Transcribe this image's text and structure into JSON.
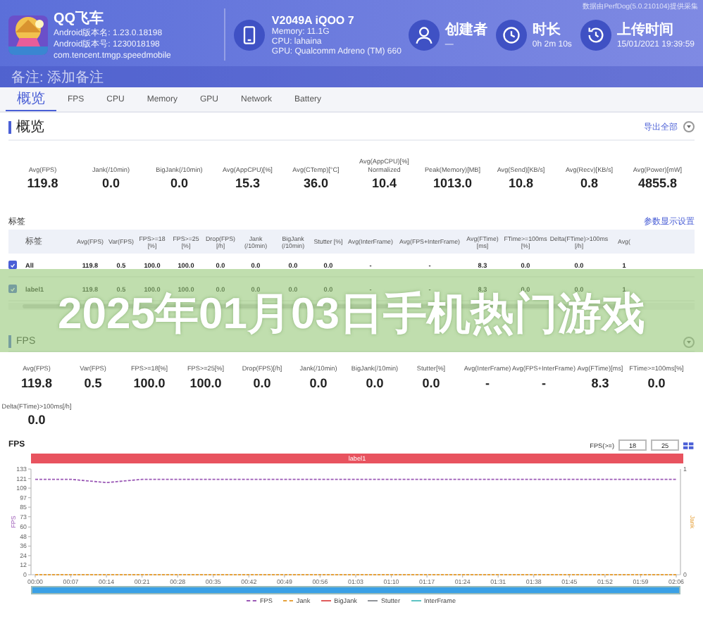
{
  "header": {
    "app": {
      "name": "QQ飞车",
      "version_name": "Android版本名: 1.23.0.18198",
      "version_code": "Android版本号: 1230018198",
      "package": "com.tencent.tmgp.speedmobile"
    },
    "device": {
      "model": "V2049A iQOO 7",
      "memory": "Memory: 11.1G",
      "cpu": "CPU: lahaina",
      "gpu": "GPU: Qualcomm Adreno (TM) 660"
    },
    "info": [
      {
        "kind": "person",
        "label": "创建者",
        "value": "—"
      },
      {
        "kind": "clock",
        "label": "时长",
        "value": "0h 2m 10s"
      },
      {
        "kind": "history",
        "label": "上传时间",
        "value": "15/01/2021 19:39:59"
      }
    ],
    "source_note": "数据由PerfDog(5.0.210104)提供采集",
    "remark": "备注: 添加备注"
  },
  "tabs": [
    {
      "label": "概览",
      "selected": true
    },
    {
      "label": "FPS",
      "selected": false
    },
    {
      "label": "CPU",
      "selected": false
    },
    {
      "label": "Memory",
      "selected": false
    },
    {
      "label": "GPU",
      "selected": false
    },
    {
      "label": "Network",
      "selected": false
    },
    {
      "label": "Battery",
      "selected": false
    }
  ],
  "overview": {
    "title": "概览",
    "link": "导出全部",
    "stats": [
      {
        "label": "Avg(FPS)",
        "value": "119.8"
      },
      {
        "label": "Jank(/10min)",
        "value": "0.0"
      },
      {
        "label": "BigJank(/10min)",
        "value": "0.0"
      },
      {
        "label": "Avg(AppCPU)[%]",
        "value": "15.3"
      },
      {
        "label": "Avg(CTemp)[°C]",
        "value": "36.0"
      },
      {
        "label": "Avg(AppCPU)[%] Normalized",
        "value": "10.4"
      },
      {
        "label": "Peak(Memory)[MB]",
        "value": "1013.0"
      },
      {
        "label": "Avg(Send)[KB/s]",
        "value": "10.8"
      },
      {
        "label": "Avg(Recv)[KB/s]",
        "value": "0.8"
      },
      {
        "label": "Avg(Power)[mW]",
        "value": "4855.8"
      }
    ]
  },
  "labels": {
    "title": "标签",
    "link": "参数显示设置",
    "columns": [
      "标签",
      "Avg(FPS)",
      "Var(FPS)",
      "FPS>=18 [%]",
      "FPS>=25 [%]",
      "Drop(FPS) [/h]",
      "Jank (/10min)",
      "BigJank (/10min)",
      "Stutter [%]",
      "Avg(InterFrame)",
      "Avg(FPS+InterFrame)",
      "Avg(FTime) [ms]",
      "FTime>=100ms [%]",
      "Delta(FTime)>100ms [/h]",
      "Avg("
    ],
    "rows": [
      {
        "checked": true,
        "cells": [
          "All",
          "119.8",
          "0.5",
          "100.0",
          "100.0",
          "0.0",
          "0.0",
          "0.0",
          "0.0",
          "-",
          "-",
          "8.3",
          "0.0",
          "0.0",
          "1"
        ]
      },
      {
        "checked": true,
        "cells": [
          "label1",
          "119.8",
          "0.5",
          "100.0",
          "100.0",
          "0.0",
          "0.0",
          "0.0",
          "0.0",
          "-",
          "-",
          "8.3",
          "0.0",
          "0.0",
          "1"
        ]
      }
    ]
  },
  "banner": {
    "title": "2025年01月03日手机热门游戏"
  },
  "fps": {
    "title": "FPS",
    "stats": [
      {
        "label": "Avg(FPS)",
        "value": "119.8"
      },
      {
        "label": "Var(FPS)",
        "value": "0.5"
      },
      {
        "label": "FPS>=18[%]",
        "value": "100.0"
      },
      {
        "label": "FPS>=25[%]",
        "value": "100.0"
      },
      {
        "label": "Drop(FPS)[/h]",
        "value": "0.0"
      },
      {
        "label": "Jank(/10min)",
        "value": "0.0"
      },
      {
        "label": "BigJank(/10min)",
        "value": "0.0"
      },
      {
        "label": "Stutter[%]",
        "value": "0.0"
      },
      {
        "label": "Avg(InterFrame)",
        "value": "-"
      },
      {
        "label": "Avg(FPS+InterFrame)",
        "value": "-"
      },
      {
        "label": "Avg(FTime)[ms]",
        "value": "8.3"
      },
      {
        "label": "FTime>=100ms[%]",
        "value": "0.0"
      },
      {
        "label": "Delta(FTime)>100ms[/h]",
        "value": "0.0"
      }
    ],
    "chart": {
      "title": "FPS",
      "threshold_label": "FPS(>=)",
      "threshold_low": "18",
      "threshold_high": "25",
      "band_label": "label1",
      "right_axis": {
        "label": "Jank",
        "ticks": [
          "1",
          "0"
        ]
      },
      "zoom": {
        "level": 1
      },
      "chart_data": {
        "type": "line",
        "ylabel": "FPS",
        "x": [
          "00:00",
          "00:07",
          "00:14",
          "00:21",
          "00:28",
          "00:35",
          "00:42",
          "00:49",
          "00:56",
          "01:03",
          "01:10",
          "01:17",
          "01:24",
          "01:31",
          "01:38",
          "01:45",
          "01:52",
          "01:59",
          "02:06"
        ],
        "ylim": [
          0,
          133
        ],
        "yticks": [
          0,
          12,
          24,
          36,
          48,
          60,
          73,
          85,
          97,
          109,
          121,
          133
        ],
        "series": [
          {
            "name": "FPS",
            "color": "#9b59b6",
            "line_style": "dashed",
            "values": [
              120,
              120,
              116,
              120,
              120,
              120,
              120,
              120,
              120,
              120,
              120,
              120,
              120,
              120,
              120,
              120,
              120,
              120,
              120
            ]
          },
          {
            "name": "Jank",
            "color": "#e6a23c",
            "line_style": "dashed",
            "values": [
              0,
              0,
              0,
              0,
              0,
              0,
              0,
              0,
              0,
              0,
              0,
              0,
              0,
              0,
              0,
              0,
              0,
              0,
              0
            ]
          },
          {
            "name": "BigJank",
            "color": "#e05c5c",
            "line_style": "solid",
            "values": [
              null,
              null,
              null,
              null,
              null,
              null,
              null,
              null,
              null,
              null,
              null,
              null,
              null,
              null,
              null,
              null,
              null,
              null,
              null
            ]
          },
          {
            "name": "Stutter",
            "color": "#909399",
            "line_style": "solid",
            "values": [
              null,
              null,
              null,
              null,
              null,
              null,
              null,
              null,
              null,
              null,
              null,
              null,
              null,
              null,
              null,
              null,
              null,
              null,
              null
            ]
          },
          {
            "name": "InterFrame",
            "color": "#5fc4c4",
            "line_style": "solid",
            "values": [
              null,
              null,
              null,
              null,
              null,
              null,
              null,
              null,
              null,
              null,
              null,
              null,
              null,
              null,
              null,
              null,
              null,
              null,
              null
            ]
          }
        ]
      }
    }
  }
}
